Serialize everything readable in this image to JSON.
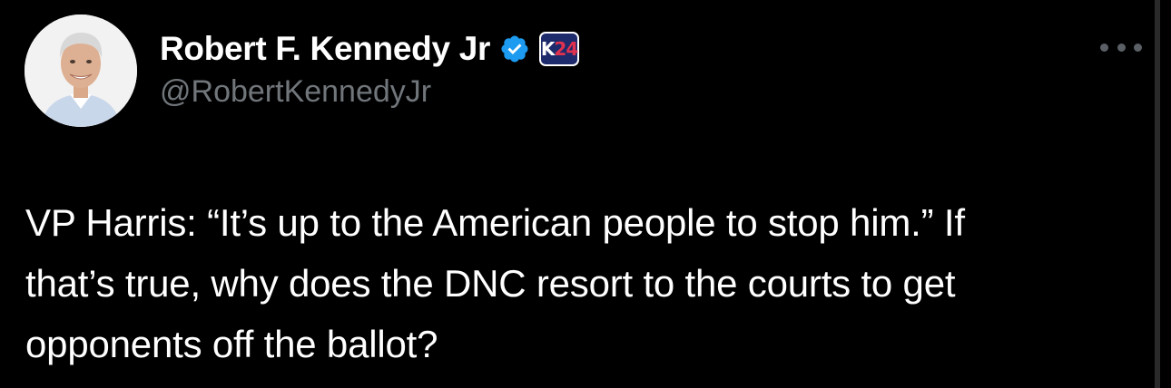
{
  "tweet": {
    "author": {
      "display_name": "Robert F. Kennedy Jr",
      "handle": "@RobertKennedyJr",
      "avatar_icon": "profile-photo",
      "verified": true,
      "verified_color": "#1d9bf0",
      "affiliate_badge": {
        "text_main": "K",
        "text_accent": "24"
      }
    },
    "text": "VP Harris: “It’s up to the American people to stop him.” If\nthat’s true, why does the DNC resort to the courts to get\nopponents off the ballot?",
    "more_icon": "more-horizontal-icon"
  }
}
